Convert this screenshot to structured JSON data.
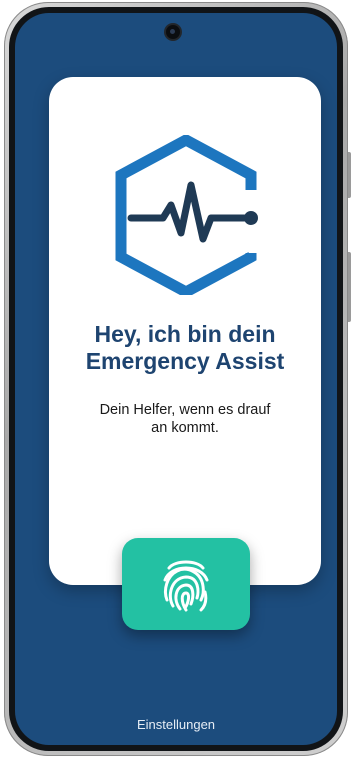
{
  "welcome": {
    "title": "Hey, ich bin dein\nEmergency Assist",
    "subtitle": "Dein Helfer, wenn es drauf\nan kommt."
  },
  "actions": {
    "fingerprint_icon": "fingerprint-icon",
    "settings_label": "Einstellungen"
  },
  "logo": {
    "icon": "hexagon-heartbeat-icon"
  },
  "colors": {
    "background": "#1c4c7d",
    "card": "#ffffff",
    "title": "#1e4470",
    "logo_blue": "#1d76bf",
    "logo_dark": "#1f3a55",
    "accent_green": "#23c1a3"
  }
}
